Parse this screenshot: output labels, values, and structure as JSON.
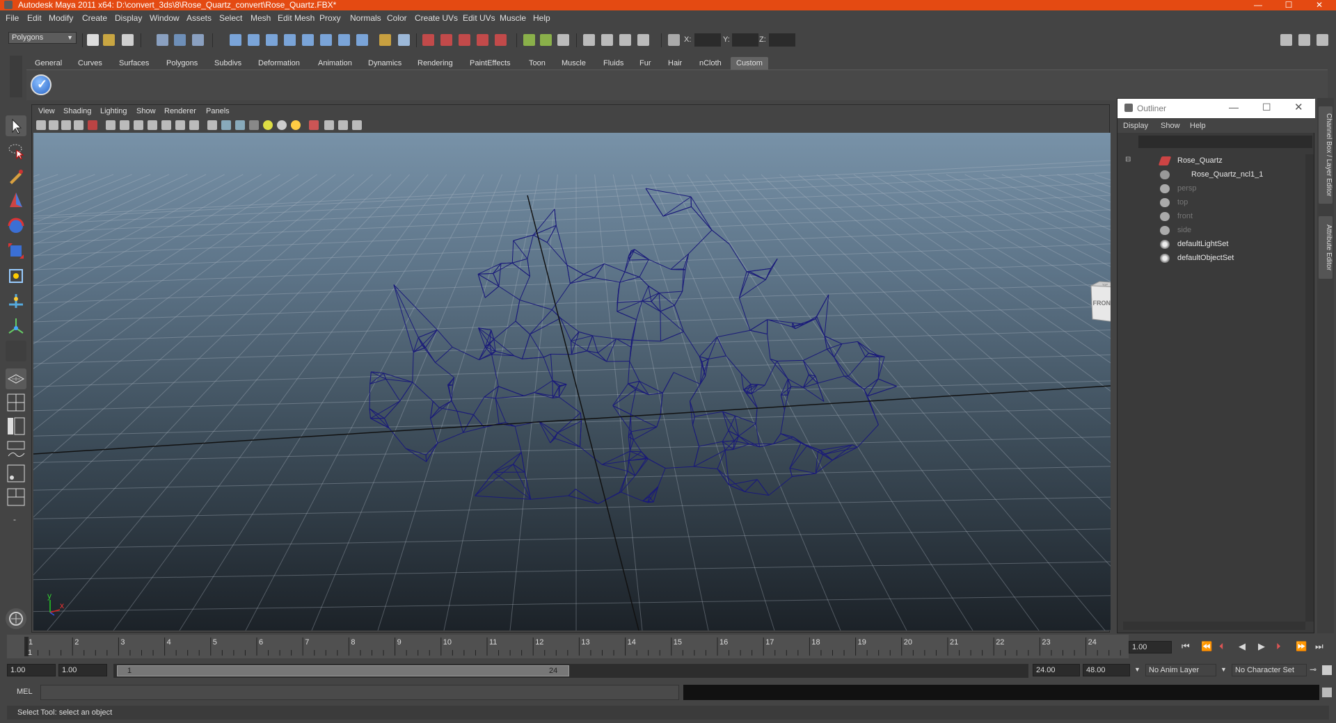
{
  "window": {
    "title": "Autodesk Maya 2011 x64: D:\\convert_3ds\\8\\Rose_Quartz_convert\\Rose_Quartz.FBX*",
    "controls": [
      "—",
      "☐",
      "✕"
    ]
  },
  "menubar": [
    "File",
    "Edit",
    "Modify",
    "Create",
    "Display",
    "Window",
    "Assets",
    "Select",
    "Mesh",
    "Edit Mesh",
    "Proxy",
    "Normals",
    "Color",
    "Create UVs",
    "Edit UVs",
    "Muscle",
    "Help"
  ],
  "statusline": {
    "mode": "Polygons",
    "x_label": "X:",
    "y_label": "Y:",
    "z_label": "Z:"
  },
  "shelf_tabs": [
    "General",
    "Curves",
    "Surfaces",
    "Polygons",
    "Subdivs",
    "Deformation",
    "Animation",
    "Dynamics",
    "Rendering",
    "PaintEffects",
    "Toon",
    "Muscle",
    "Fluids",
    "Fur",
    "Hair",
    "nCloth",
    "Custom"
  ],
  "shelf_active": "Custom",
  "viewport_menu": [
    "View",
    "Shading",
    "Lighting",
    "Show",
    "Renderer",
    "Panels"
  ],
  "viewcube": {
    "top": "TOP",
    "front": "FRONT"
  },
  "axis": {
    "y": "y",
    "x": "x"
  },
  "outliner": {
    "title": "Outliner",
    "menu": [
      "Display",
      "Show",
      "Help"
    ],
    "items": [
      {
        "label": "Rose_Quartz",
        "icon": "transform-icon",
        "dim": false
      },
      {
        "label": "Rose_Quartz_ncl1_1",
        "icon": "mesh-icon",
        "dim": false
      },
      {
        "label": "persp",
        "icon": "camera-icon",
        "dim": true
      },
      {
        "label": "top",
        "icon": "camera-icon",
        "dim": true
      },
      {
        "label": "front",
        "icon": "camera-icon",
        "dim": true
      },
      {
        "label": "side",
        "icon": "camera-icon",
        "dim": true
      },
      {
        "label": "defaultLightSet",
        "icon": "set-icon",
        "dim": false
      },
      {
        "label": "defaultObjectSet",
        "icon": "set-icon",
        "dim": false
      }
    ]
  },
  "side_tabs": [
    "Channel Box / Layer Editor",
    "Attribute Editor"
  ],
  "timeline": {
    "ticks": [
      "1",
      "2",
      "3",
      "4",
      "5",
      "6",
      "7",
      "8",
      "9",
      "10",
      "11",
      "12",
      "13",
      "14",
      "15",
      "16",
      "17",
      "18",
      "19",
      "20",
      "21",
      "22",
      "23",
      "24"
    ],
    "current_frame": "1",
    "current_time": "1.00"
  },
  "range": {
    "start": "1.00",
    "playback_start": "1.00",
    "slider_start": "1",
    "slider_end": "24",
    "playback_end": "24.00",
    "end": "48.00",
    "anim_layer": "No Anim Layer",
    "character_set": "No Character Set"
  },
  "command": {
    "label": "MEL"
  },
  "helpline": "Select Tool: select an object",
  "colors": {
    "titlebar": "#e44a12",
    "wireframe": "#1a1a7a",
    "ui_bg": "#444444"
  }
}
